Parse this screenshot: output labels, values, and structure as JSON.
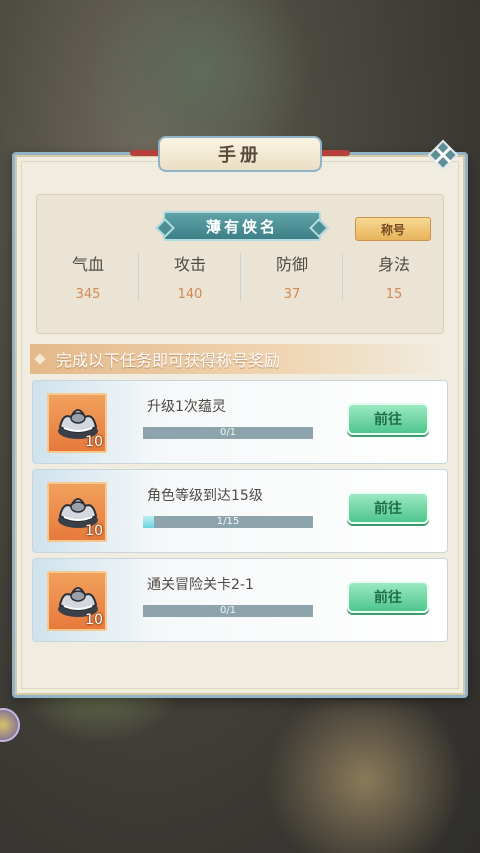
{
  "header": {
    "title": "手册"
  },
  "profile": {
    "name": "薄有侠名",
    "badge": "称号",
    "stats": [
      {
        "label": "气血",
        "value": "345"
      },
      {
        "label": "攻击",
        "value": "140"
      },
      {
        "label": "防御",
        "value": "37"
      },
      {
        "label": "身法",
        "value": "15"
      }
    ]
  },
  "banner": {
    "text": "完成以下任务即可获得称号奖励"
  },
  "tasks": [
    {
      "title": "升级1次蕴灵",
      "progress_text": "0/1",
      "progress": 0.0,
      "reward_count": "10",
      "button": "前往"
    },
    {
      "title": "角色等级到达15级",
      "progress_text": "1/15",
      "progress": 0.0667,
      "reward_count": "10",
      "button": "前往"
    },
    {
      "title": "通关冒险关卡2-1",
      "progress_text": "0/1",
      "progress": 0.0,
      "reward_count": "10",
      "button": "前往"
    }
  ],
  "icons": {
    "close": "close-icon",
    "reward": "silver-ingot-icon"
  },
  "colors": {
    "accent": "#4fc58d",
    "stat_value": "#d08a54",
    "frame": "#8fb4c8"
  }
}
